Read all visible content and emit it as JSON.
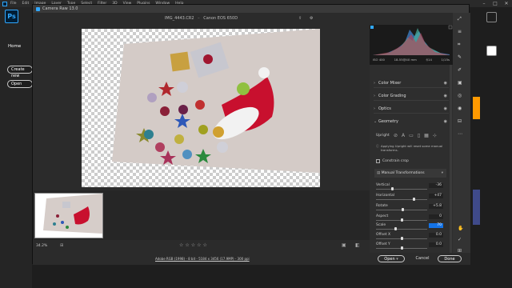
{
  "menubar": {
    "items": [
      "File",
      "Edit",
      "Image",
      "Layer",
      "Type",
      "Select",
      "Filter",
      "3D",
      "View",
      "Plugins",
      "Window",
      "Help"
    ]
  },
  "ps_home": {
    "logo": "Ps",
    "home_label": "Home",
    "create_new_label": "Create new",
    "open_label": "Open"
  },
  "dialog": {
    "title": "Camera Raw 13.0",
    "filename": "IMG_4443.CR2",
    "camera": "Canon EOS 650D",
    "zoom": "34.2%",
    "workflow": "Adobe RGB (1998) - 8 bit - 5184 x 3456 (17.9MP) - 300 ppi",
    "buttons": {
      "open": "Open",
      "cancel": "Cancel",
      "done": "Done"
    }
  },
  "histogram": {
    "info": [
      "ISO 400",
      "18-55@40 mm",
      "f/14",
      "1/15s"
    ]
  },
  "panel": {
    "sections": [
      "Color Mixer",
      "Color Grading",
      "Optics",
      "Geometry"
    ],
    "upright_label": "Upright",
    "upright_note": "Applying Upright will reset some manual transforms.",
    "constrain_crop": "Constrain crop",
    "manual_transforms": "Manual Transformations",
    "sliders": [
      {
        "label": "Vertical",
        "value": "-36",
        "fraction": 0.32
      },
      {
        "label": "Horizontal",
        "value": "+47",
        "fraction": 0.74
      },
      {
        "label": "Rotate",
        "value": "+5.8",
        "fraction": 0.53
      },
      {
        "label": "Aspect",
        "value": "0",
        "fraction": 0.5
      },
      {
        "label": "Scale",
        "value": "70",
        "fraction": 0.38
      },
      {
        "label": "Offset X",
        "value": "0.0",
        "fraction": 0.5
      },
      {
        "label": "Offset Y",
        "value": "0.0",
        "fraction": 0.5
      }
    ]
  }
}
